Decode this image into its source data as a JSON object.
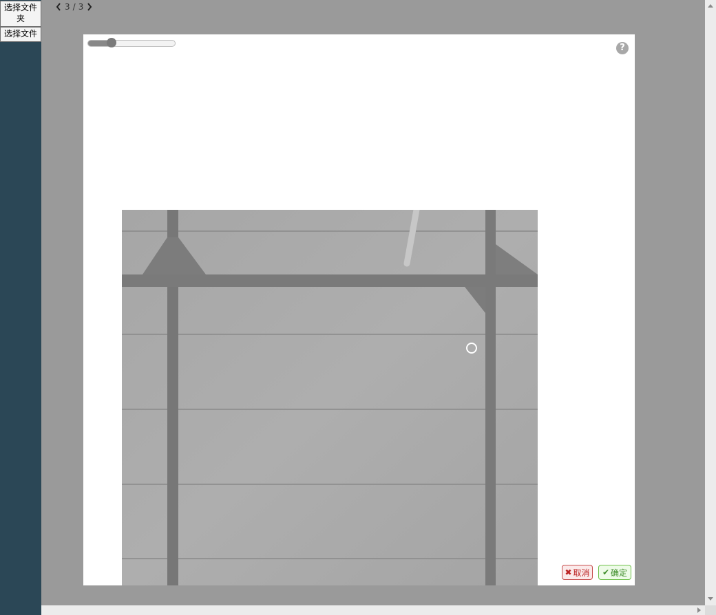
{
  "sidebar": {
    "select_folder_label": "选择文件夹",
    "select_file_label": "选择文件"
  },
  "pager": {
    "current": "3",
    "separator": "/",
    "total": "3"
  },
  "zoom": {
    "level": 0.27
  },
  "dialog": {
    "help_label": "?",
    "cancel_label": "取消",
    "confirm_label": "确定"
  },
  "colors": {
    "sidebar": "#2b4756",
    "cancel": "#c64b4b",
    "confirm": "#6cbf48"
  }
}
